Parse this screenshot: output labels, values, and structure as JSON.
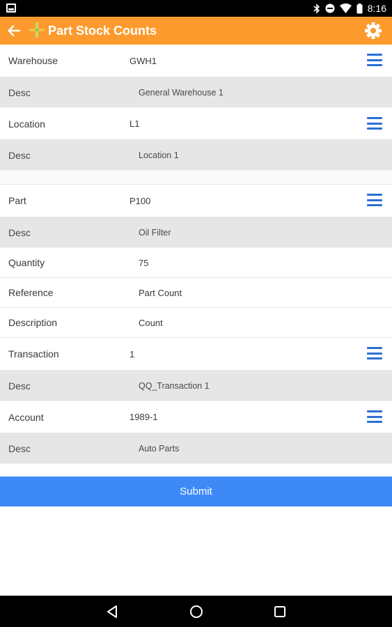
{
  "status_bar": {
    "time": "8:16",
    "icons": [
      "notification-icon",
      "bluetooth-icon",
      "do-not-disturb-icon",
      "wifi-icon",
      "battery-icon"
    ]
  },
  "app_bar": {
    "title": "Part Stock Counts",
    "back_icon": "arrow-left-icon",
    "settings_icon": "gear-icon",
    "colors": {
      "background": "#fd9a2d"
    }
  },
  "form": {
    "warehouse": {
      "label": "Warehouse",
      "value": "GWH1"
    },
    "warehouse_desc": {
      "label": "Desc",
      "value": "General Warehouse 1"
    },
    "location": {
      "label": "Location",
      "value": "L1"
    },
    "location_desc": {
      "label": "Desc",
      "value": "Location 1"
    },
    "part": {
      "label": "Part",
      "value": "P100"
    },
    "part_desc": {
      "label": "Desc",
      "value": "Oil Filter"
    },
    "quantity": {
      "label": "Quantity",
      "value": "75"
    },
    "reference": {
      "label": "Reference",
      "value": "Part Count"
    },
    "description": {
      "label": "Description",
      "value": "Count"
    },
    "transaction": {
      "label": "Transaction",
      "value": "1"
    },
    "transaction_desc": {
      "label": "Desc",
      "value": "QQ_Transaction 1"
    },
    "account": {
      "label": "Account",
      "value": "1989-1"
    },
    "account_desc": {
      "label": "Desc",
      "value": "Auto Parts"
    }
  },
  "submit_label": "Submit",
  "colors": {
    "accent": "#3d8af7",
    "menu_icon": "#2a6fd6",
    "desc_row": "#e6e6e6"
  },
  "nav_bar": {
    "icons": [
      "back-triangle-icon",
      "home-circle-icon",
      "recents-square-icon"
    ]
  }
}
